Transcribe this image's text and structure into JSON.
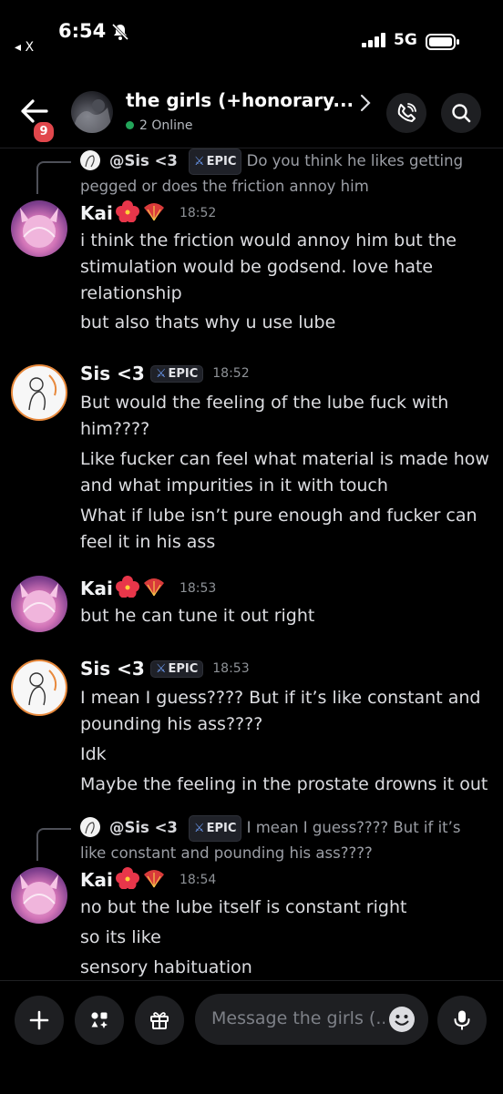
{
  "status_bar": {
    "time": "6:54",
    "back_app": "◂ X",
    "network": "5G"
  },
  "header": {
    "unread_count": "9",
    "title": "the girls (+honorary...",
    "online": "2 Online"
  },
  "messages": [
    {
      "type": "reply",
      "reply_author": "@Sis <3",
      "reply_badge": "EPIC",
      "reply_text": "Do you think he likes getting pegged or does the friction annoy him"
    },
    {
      "type": "message",
      "author": "Kai",
      "time": "18:52",
      "lines": [
        "i think the friction would annoy him but the stimulation would be godsend. love hate relationship",
        "but also thats why u use lube"
      ]
    },
    {
      "type": "message",
      "author": "Sis <3",
      "badge": "EPIC",
      "time": "18:52",
      "lines": [
        "But would the feeling of the lube fuck with him????",
        "Like fucker can feel what material is made how and what impurities in it with touch",
        "What if lube isn’t pure enough and fucker can feel it in his ass"
      ]
    },
    {
      "type": "message",
      "author": "Kai",
      "time": "18:53",
      "lines": [
        "but he can tune it out right"
      ]
    },
    {
      "type": "message",
      "author": "Sis <3",
      "badge": "EPIC",
      "time": "18:53",
      "lines": [
        "I mean I guess???? But if it’s like constant and pounding his ass????",
        "Idk",
        "Maybe the feeling in the prostate drowns it out"
      ]
    },
    {
      "type": "reply",
      "reply_author": "@Sis <3",
      "reply_badge": "EPIC",
      "reply_text": "I mean I guess???? But if it’s like constant and pounding his ass????"
    },
    {
      "type": "message",
      "author": "Kai",
      "time": "18:54",
      "lines": [
        "no but the lube itself is constant right",
        "so its like",
        "sensory habituation"
      ]
    }
  ],
  "composer": {
    "placeholder": "Message the girls (.."
  },
  "colors": {
    "background": "#000000",
    "online_dot": "#23a55a",
    "badge_red": "#e1474c",
    "muted_text": "#8e9297"
  },
  "icons": [
    "bell-slash-icon",
    "signal-icon",
    "battery-icon",
    "back-arrow-icon",
    "chevron-right-icon",
    "phone-icon",
    "search-icon",
    "plus-icon",
    "apps-icon",
    "gift-icon",
    "emoji-icon",
    "mic-icon",
    "hibiscus-emoji",
    "fan-emoji"
  ]
}
